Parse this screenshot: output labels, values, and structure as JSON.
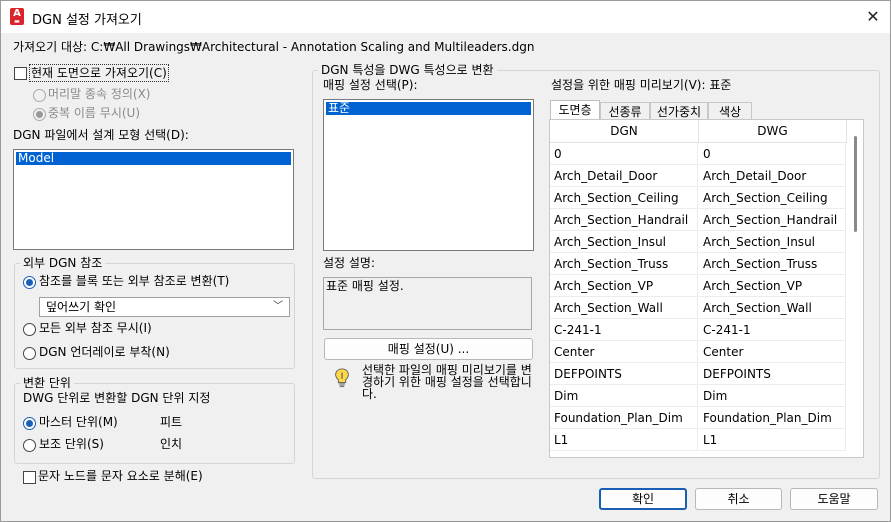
{
  "window": {
    "title": "DGN 설정 가져오기",
    "close_glyph": "✕",
    "app_icon_letter": "A"
  },
  "import_target": "가져오기 대상: C:₩All Drawings₩Architectural - Annotation Scaling and Multileaders.dgn",
  "left": {
    "import_current_layout": "현재 도면으로 가져오기(C)",
    "prefix_dependent": "머리말 종속 정의(X)",
    "ignore_duplicate": "중복 이름 무시(U)",
    "design_model_label": "DGN 파일에서 설계 모형 선택(D):",
    "design_models": [
      "Model"
    ],
    "xref_group": {
      "title": "외부 DGN 참조",
      "convert_to_block": "참조를 블록 또는 외부 참조로 변환(T)",
      "overwrite_option": "덮어쓰기 확인",
      "ignore_all": "모든 외부 참조 무시(I)",
      "attach_underlay": "DGN 언더레이로 부착(N)"
    },
    "units_group": {
      "title": "변환 단위",
      "desc": "DWG 단위로 변환할 DGN 단위 지정",
      "master_units": "마스터 단위(M)",
      "master_value": "피트",
      "sub_units": "보조 단위(S)",
      "sub_value": "인치"
    },
    "explode_text": "문자 노드를 문자 요소로 분해(E)"
  },
  "middle": {
    "group_title": "DGN 특성을 DWG 특성으로 변환",
    "mapping_select_label": "매핑 설정 선택(P):",
    "mappings": [
      "표준"
    ],
    "desc_label": "설정 설명:",
    "desc_text": "표준 매핑 설정.",
    "mapping_setup_button": "매핑 설정(U) ...",
    "hint": "선택한 파일의 매핑 미리보기를 변경하기 위한 매핑 설정을 선택합니다."
  },
  "preview": {
    "label": "설정을 위한 매핑 미리보기(V): 표준",
    "tabs": [
      "도면층",
      "선종류",
      "선가중치",
      "색상"
    ],
    "active_tab": 0,
    "columns": [
      "DGN",
      "DWG"
    ],
    "rows": [
      [
        "0",
        "0"
      ],
      [
        "Arch_Detail_Door",
        "Arch_Detail_Door"
      ],
      [
        "Arch_Section_Ceiling",
        "Arch_Section_Ceiling"
      ],
      [
        "Arch_Section_Handrail",
        "Arch_Section_Handrail"
      ],
      [
        "Arch_Section_Insul",
        "Arch_Section_Insul"
      ],
      [
        "Arch_Section_Truss",
        "Arch_Section_Truss"
      ],
      [
        "Arch_Section_VP",
        "Arch_Section_VP"
      ],
      [
        "Arch_Section_Wall",
        "Arch_Section_Wall"
      ],
      [
        "C-241-1",
        "C-241-1"
      ],
      [
        "Center",
        "Center"
      ],
      [
        "DEFPOINTS",
        "DEFPOINTS"
      ],
      [
        "Dim",
        "Dim"
      ],
      [
        "Foundation_Plan_Dim",
        "Foundation_Plan_Dim"
      ],
      [
        "L1",
        "L1"
      ]
    ]
  },
  "buttons": {
    "ok": "확인",
    "cancel": "취소",
    "help": "도움말"
  },
  "colors": {
    "accent": "#1a5fb4",
    "selection": "#0063d1",
    "app_icon": "#d9232d"
  }
}
